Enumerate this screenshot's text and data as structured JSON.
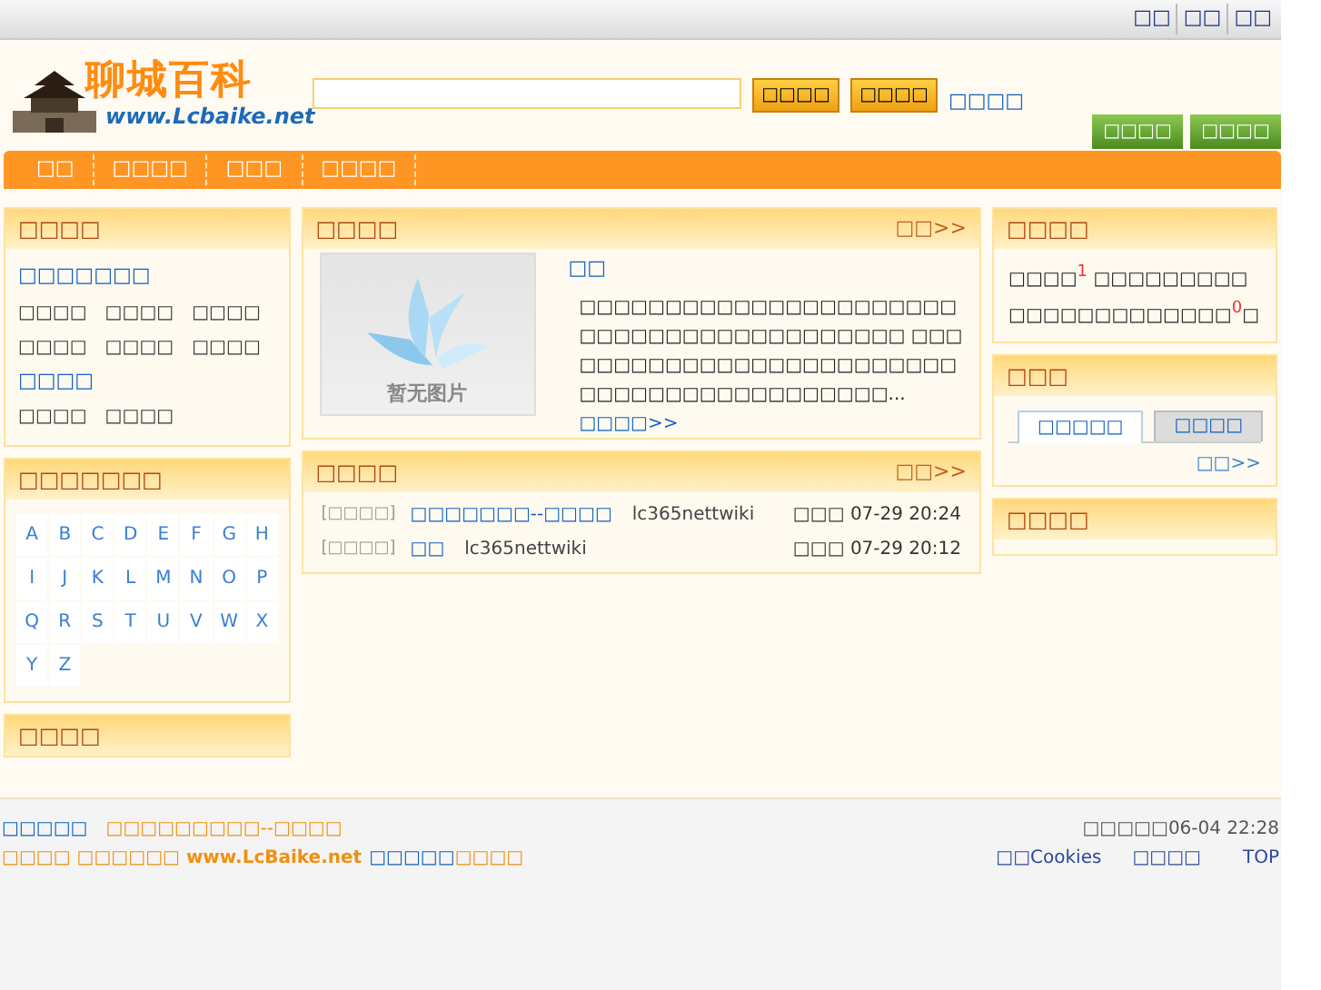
{
  "top_links": [
    "□□",
    "□□",
    "□□"
  ],
  "logo": {
    "title": "聊城百科",
    "url": "www.Lcbaike.net"
  },
  "search": {
    "buttons": [
      "□□□□",
      "□□□□"
    ],
    "link": "□□□□"
  },
  "account_buttons": [
    "□□□□",
    "□□□□"
  ],
  "nav": [
    "□□",
    "□□□□",
    "□□□",
    "□□□□"
  ],
  "categories": {
    "title": "□□□□",
    "groups": [
      {
        "heading": "□□□□□□□",
        "items": [
          "□□□□",
          "□□□□",
          "□□□□",
          "□□□□",
          "□□□□",
          "□□□□"
        ]
      },
      {
        "heading": "□□□□",
        "items": [
          "□□□□",
          "□□□□"
        ]
      }
    ]
  },
  "letters": {
    "title": "□□□□□□□",
    "items": [
      "A",
      "B",
      "C",
      "D",
      "E",
      "F",
      "G",
      "H",
      "I",
      "J",
      "K",
      "L",
      "M",
      "N",
      "O",
      "P",
      "Q",
      "R",
      "S",
      "T",
      "U",
      "V",
      "W",
      "X",
      "Y",
      "Z"
    ]
  },
  "left_bottom": {
    "title": "□□□□"
  },
  "featured": {
    "title": "□□□□",
    "more": "□□>>",
    "image_caption": "暂无图片",
    "entry_title": "□□",
    "text": "□□□□□□□□□□□□□□□□□□□□□□ □□□□□□□□□□□□□□□□□□□ □□□□□□□□□□□□□□□□□□□□□□□□□□□□□□□□□□□□□□□□□□□...",
    "read_more": "□□□□>>"
  },
  "recent": {
    "title": "□□□□",
    "more": "□□>>",
    "rows": [
      {
        "category": "[□□□□]",
        "title": "□□□□□□□--□□□□",
        "user": "lc365nettwiki",
        "time": "□□□ 07-29 20:24"
      },
      {
        "category": "[□□□□]",
        "title": "□□",
        "user": "lc365nettwiki",
        "time": "□□□ 07-29 20:12"
      }
    ]
  },
  "stats": {
    "title": "□□□□",
    "parts": [
      {
        "kind": "plain",
        "text": "□□□□"
      },
      {
        "kind": "number",
        "text": "1"
      },
      {
        "kind": "plain",
        "text": " □□□□□□□□□□□□□□□□□□□□□□"
      },
      {
        "kind": "number",
        "text": "0"
      },
      {
        "kind": "plain",
        "text": "□"
      }
    ]
  },
  "ranking": {
    "title": "□□□",
    "tabs": [
      {
        "label": "□□□□□",
        "selected": true
      },
      {
        "label": "□□□□",
        "selected": false
      }
    ],
    "more": "□□>>"
  },
  "right_bottom": {
    "title": "□□□□"
  },
  "footer": {
    "link": "□□□□□",
    "slogan": "□□□□□□□□□--□□□□",
    "time": "□□□□□06-04 22:28",
    "line2_site": "□□□□ □□□□□□ www.LcBaike.net",
    "line2_link": "□□□□□",
    "line2_tail": "□□□□",
    "links": [
      "□□Cookies",
      "□□□□",
      "TOP"
    ]
  }
}
